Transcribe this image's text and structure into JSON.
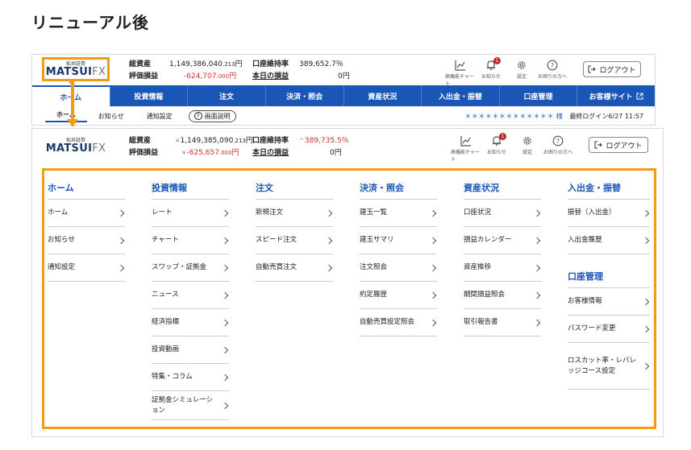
{
  "page_title": "リニューアル後",
  "colors": {
    "accent": "#1a56b5",
    "highlight": "#f39c12",
    "negative": "#d32f2f"
  },
  "logo": {
    "sub": "松井証券",
    "main": "MATSUI",
    "fx": "FX"
  },
  "v1": {
    "total_assets_label": "総資産",
    "total_assets_main": "1,149,386,040",
    "total_assets_dec": ".213",
    "total_assets_unit": "円",
    "pl_label": "評価損益",
    "pl_main": "-624,707",
    "pl_dec": ".000",
    "pl_unit": "円",
    "margin_label": "口座維持率",
    "margin_value": "389,652.7％",
    "today_label": "本日の損益",
    "today_value": "0円",
    "tools": [
      {
        "icon": "chart-line-icon",
        "label": "高機能チャート"
      },
      {
        "icon": "bell-icon",
        "label": "お知らせ",
        "badge": "1"
      },
      {
        "icon": "gear-icon",
        "label": "設定"
      },
      {
        "icon": "help-icon",
        "label": "お困りの方へ"
      }
    ],
    "logout": "ログアウト",
    "nav": [
      "ホーム",
      "投資情報",
      "注文",
      "決済・照会",
      "資産状況",
      "入出金・振替",
      "口座管理",
      "お客様サイト"
    ],
    "subnav": [
      "ホーム",
      "お知らせ",
      "通知設定"
    ],
    "screen_help": "画面説明",
    "user": "＊＊＊＊＊＊＊＊＊＊＊＊＊ 様",
    "last_login": "最終ログイン6/27 11:57"
  },
  "v2": {
    "total_assets_label": "総資産",
    "total_assets_mark": "¥",
    "total_assets_main": "1,149,385,090",
    "total_assets_dec": ".213",
    "total_assets_unit": "円",
    "pl_label": "評価損益",
    "pl_mark": "¥",
    "pl_main": "-625,657",
    "pl_dec": ".000",
    "pl_unit": "円",
    "margin_label": "口座維持率",
    "margin_mark": "^",
    "margin_value": "389,735.5％",
    "today_label": "本日の損益",
    "today_value": "0円",
    "tools": [
      {
        "icon": "chart-line-icon",
        "label": "高機能チャート"
      },
      {
        "icon": "bell-icon",
        "label": "お知らせ",
        "badge": "1"
      },
      {
        "icon": "gear-icon",
        "label": "設定"
      },
      {
        "icon": "help-icon",
        "label": "お困りの方へ"
      }
    ],
    "logout": "ログアウト"
  },
  "mega": [
    {
      "title": "ホーム",
      "items": [
        "ホーム",
        "お知らせ",
        "通知設定"
      ]
    },
    {
      "title": "投資情報",
      "items": [
        "レート",
        "チャート",
        "スワップ・証拠金",
        "ニュース",
        "経済指標",
        "投資動画",
        "特集・コラム",
        "証拠金シミュレーション"
      ]
    },
    {
      "title": "注文",
      "items": [
        "新規注文",
        "スピード注文",
        "自動売買注文"
      ]
    },
    {
      "title": "決済・照会",
      "items": [
        "建玉一覧",
        "建玉サマリ",
        "注文照会",
        "約定履歴",
        "自動売買設定照会"
      ]
    },
    {
      "title": "資産状況",
      "items": [
        "口座状況",
        "損益カレンダー",
        "資産推移",
        "期間損益照会",
        "取引報告書"
      ]
    },
    {
      "title": "入出金・振替",
      "items": [
        "振替（入出金）",
        "入出金履歴"
      ],
      "title2": "口座管理",
      "items2": [
        "お客様情報",
        "パスワード変更",
        "ロスカット率・レバレッジコース設定"
      ]
    }
  ]
}
